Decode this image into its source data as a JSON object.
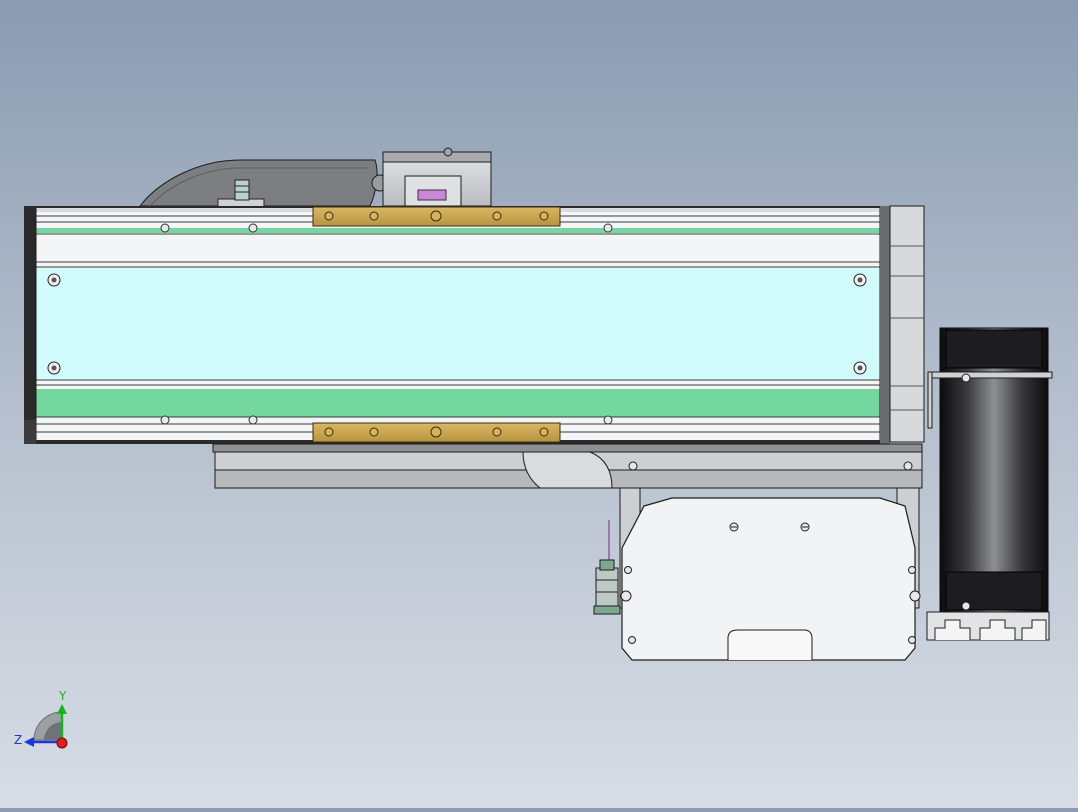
{
  "viewport": {
    "background_top": "#8b9bb1",
    "background_bottom": "#d8dde5"
  },
  "model": {
    "colors": {
      "rail_light": "#f4f5f6",
      "rail_edge": "#2a2a2a",
      "cover_cyan": "#d2fcfb",
      "strip_green": "#74d7a0",
      "slider_gold": "#c7a44e",
      "metal_gray": "#cfd1d4",
      "metal_dark": "#8e9094",
      "motor_black": "#1d1d1f",
      "connector_pink": "#c78ad2",
      "sensor_green": "#7fa890"
    }
  },
  "triad": {
    "y_label": "Y",
    "z_label": "Z",
    "y_color": "#17b320",
    "z_color": "#1d36d6",
    "x_color": "#e01e1e"
  }
}
